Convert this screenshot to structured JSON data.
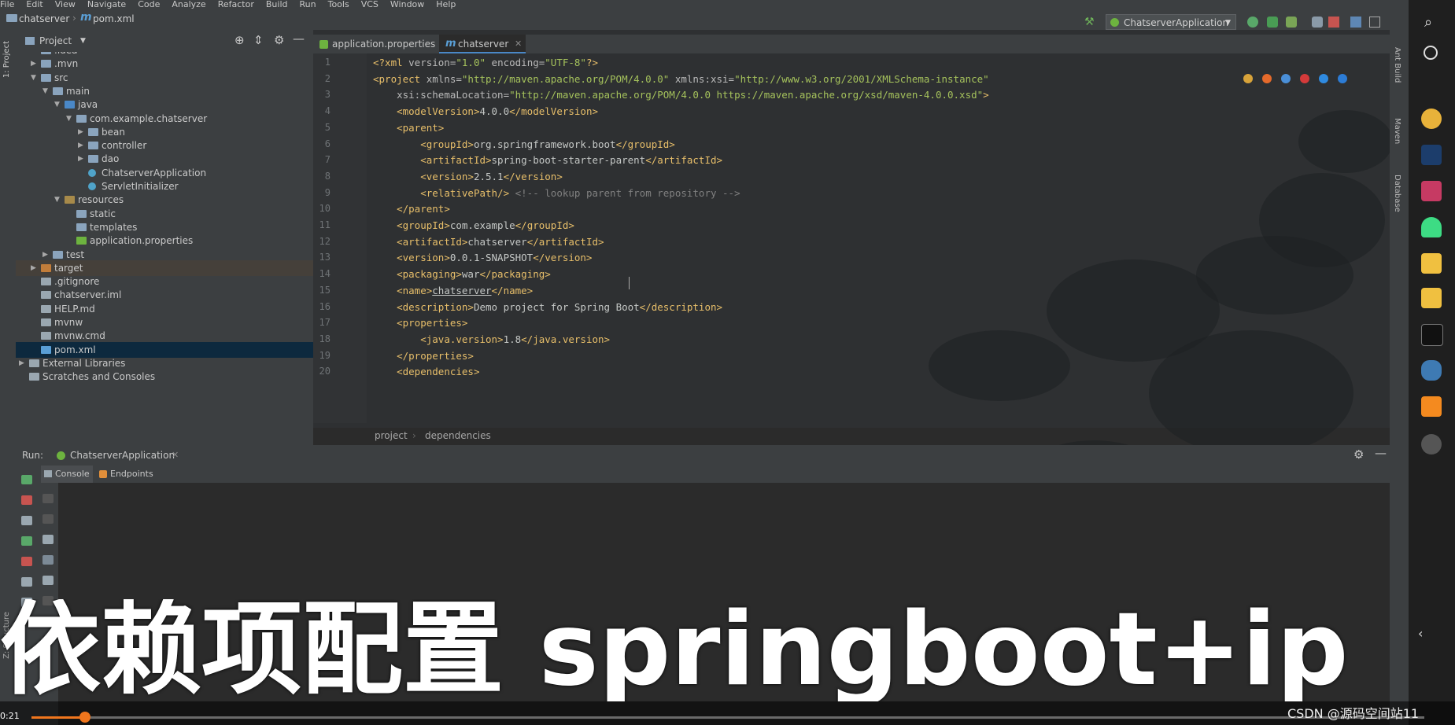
{
  "menu": [
    "File",
    "Edit",
    "View",
    "Navigate",
    "Code",
    "Analyze",
    "Refactor",
    "Build",
    "Run",
    "Tools",
    "VCS",
    "Window",
    "Help"
  ],
  "breadcrumb": {
    "project": "chatserver",
    "file": "pom.xml",
    "file_icon": "m"
  },
  "run_config": {
    "label": "ChatserverApplication"
  },
  "project_panel": {
    "title": "Project",
    "side_label": "1: Project",
    "tree": [
      {
        "label": ".idea",
        "indent": 1,
        "arrow": "",
        "type": "folder"
      },
      {
        "label": ".mvn",
        "indent": 1,
        "arrow": "▶",
        "type": "folder"
      },
      {
        "label": "src",
        "indent": 1,
        "arrow": "▼",
        "type": "folder"
      },
      {
        "label": "main",
        "indent": 2,
        "arrow": "▼",
        "type": "folder"
      },
      {
        "label": "java",
        "indent": 3,
        "arrow": "▼",
        "type": "folder-src"
      },
      {
        "label": "com.example.chatserver",
        "indent": 4,
        "arrow": "▼",
        "type": "package"
      },
      {
        "label": "bean",
        "indent": 5,
        "arrow": "▶",
        "type": "package"
      },
      {
        "label": "controller",
        "indent": 5,
        "arrow": "▶",
        "type": "package"
      },
      {
        "label": "dao",
        "indent": 5,
        "arrow": "▶",
        "type": "package"
      },
      {
        "label": "ChatserverApplication",
        "indent": 5,
        "arrow": "",
        "type": "class"
      },
      {
        "label": "ServletInitializer",
        "indent": 5,
        "arrow": "",
        "type": "class"
      },
      {
        "label": "resources",
        "indent": 3,
        "arrow": "▼",
        "type": "folder-res"
      },
      {
        "label": "static",
        "indent": 4,
        "arrow": "",
        "type": "folder"
      },
      {
        "label": "templates",
        "indent": 4,
        "arrow": "",
        "type": "folder"
      },
      {
        "label": "application.properties",
        "indent": 4,
        "arrow": "",
        "type": "props"
      },
      {
        "label": "test",
        "indent": 2,
        "arrow": "▶",
        "type": "folder"
      },
      {
        "label": "target",
        "indent": 1,
        "arrow": "▶",
        "type": "folder-excl"
      },
      {
        "label": ".gitignore",
        "indent": 1,
        "arrow": "",
        "type": "file"
      },
      {
        "label": "chatserver.iml",
        "indent": 1,
        "arrow": "",
        "type": "file"
      },
      {
        "label": "HELP.md",
        "indent": 1,
        "arrow": "",
        "type": "file"
      },
      {
        "label": "mvnw",
        "indent": 1,
        "arrow": "",
        "type": "file"
      },
      {
        "label": "mvnw.cmd",
        "indent": 1,
        "arrow": "",
        "type": "file"
      },
      {
        "label": "pom.xml",
        "indent": 1,
        "arrow": "",
        "type": "maven"
      },
      {
        "label": "External Libraries",
        "indent": 0,
        "arrow": "▶",
        "type": "lib"
      },
      {
        "label": "Scratches and Consoles",
        "indent": 0,
        "arrow": "",
        "type": "scratch"
      }
    ]
  },
  "editor": {
    "tabs": [
      {
        "label": "application.properties",
        "active": false
      },
      {
        "label": "chatserver",
        "active": true
      }
    ],
    "lines": [
      {
        "n": "1",
        "html": "<span class='tg'>&lt;?xml </span><span class='at'>version=</span><span class='st'>\"1.0\"</span><span class='at'> encoding=</span><span class='st'>\"UTF-8\"</span><span class='tg'>?&gt;</span>"
      },
      {
        "n": "2",
        "html": "<span class='tg'>&lt;project </span><span class='at'>xmlns=</span><span class='st'>\"http://maven.apache.org/POM/4.0.0\"</span><span class='at'> xmlns:xsi=</span><span class='st'>\"http://www.w3.org/2001/XMLSchema-instance\"</span>"
      },
      {
        "n": "3",
        "html": "    <span class='at'>xsi:schemaLocation=</span><span class='st'>\"http://maven.apache.org/POM/4.0.0 https://maven.apache.org/xsd/maven-4.0.0.xsd\"</span><span class='tg'>&gt;</span>"
      },
      {
        "n": "4",
        "html": "    <span class='tg'>&lt;modelVersion&gt;</span><span class='tx'>4.0.0</span><span class='tg'>&lt;/modelVersion&gt;</span>"
      },
      {
        "n": "5",
        "html": "    <span class='tg'>&lt;parent&gt;</span>"
      },
      {
        "n": "6",
        "html": "        <span class='tg'>&lt;groupId&gt;</span><span class='tx'>org.springframework.boot</span><span class='tg'>&lt;/groupId&gt;</span>"
      },
      {
        "n": "7",
        "html": "        <span class='tg'>&lt;artifactId&gt;</span><span class='tx'>spring-boot-starter-parent</span><span class='tg'>&lt;/artifactId&gt;</span>"
      },
      {
        "n": "8",
        "html": "        <span class='tg'>&lt;version&gt;</span><span class='tx'>2.5.1</span><span class='tg'>&lt;/version&gt;</span>"
      },
      {
        "n": "9",
        "html": "        <span class='tg'>&lt;relativePath/&gt;</span><span class='cm'> &lt;!-- lookup parent from repository --&gt;</span>"
      },
      {
        "n": "10",
        "html": "    <span class='tg'>&lt;/parent&gt;</span>"
      },
      {
        "n": "11",
        "html": "    <span class='tg'>&lt;groupId&gt;</span><span class='tx'>com.example</span><span class='tg'>&lt;/groupId&gt;</span>"
      },
      {
        "n": "12",
        "html": "    <span class='tg'>&lt;artifactId&gt;</span><span class='tx'>chatserver</span><span class='tg'>&lt;/artifactId&gt;</span>"
      },
      {
        "n": "13",
        "html": "    <span class='tg'>&lt;version&gt;</span><span class='tx'>0.0.1-SNAPSHOT</span><span class='tg'>&lt;/version&gt;</span>"
      },
      {
        "n": "14",
        "html": "    <span class='tg'>&lt;packaging&gt;</span><span class='tx'>war</span><span class='tg'>&lt;/packaging&gt;</span>"
      },
      {
        "n": "15",
        "html": "    <span class='tg'>&lt;name&gt;</span><span class='tx' style='text-decoration:underline'>chatserver</span><span class='tg'>&lt;/name&gt;</span>"
      },
      {
        "n": "16",
        "html": "    <span class='tg'>&lt;description&gt;</span><span class='tx'>Demo project for Spring Boot</span><span class='tg'>&lt;/description&gt;</span>"
      },
      {
        "n": "17",
        "html": "    <span class='tg'>&lt;properties&gt;</span>"
      },
      {
        "n": "18",
        "html": "        <span class='tg'>&lt;java.version&gt;</span><span class='tx'>1.8</span><span class='tg'>&lt;/java.version&gt;</span>"
      },
      {
        "n": "19",
        "html": "    <span class='tg'>&lt;/properties&gt;</span>"
      },
      {
        "n": "20",
        "html": "    <span class='tg'>&lt;dependencies&gt;</span>"
      }
    ],
    "crumbs": [
      "project",
      "dependencies"
    ]
  },
  "run_panel": {
    "label": "Run:",
    "config_tab": "ChatserverApplication",
    "tabs": [
      "Console",
      "Endpoints"
    ],
    "side_labels": [
      "Z: Structure"
    ]
  },
  "right_strip": {
    "labels": [
      "Ant Build",
      "Maven",
      "Database"
    ]
  },
  "subtitle": "依赖项配置 springboot+ip",
  "video": {
    "time": "0:21",
    "watermark": "CSDN @源码空间站11"
  },
  "colors": {
    "accent": "#4a88c7",
    "progress": "#f0761d",
    "tag": "#e8bf6a",
    "string": "#a5c25c"
  }
}
